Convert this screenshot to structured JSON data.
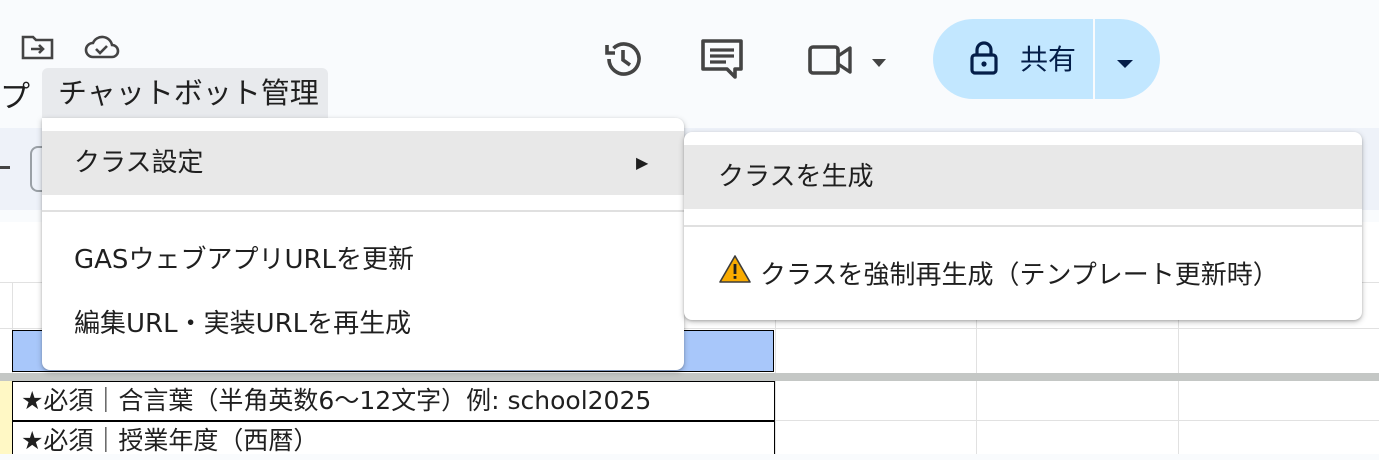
{
  "menubar": {
    "partial_label": "プ",
    "active_menu": "チャットボット管理"
  },
  "header": {
    "share_label": "共有"
  },
  "menu": {
    "items": [
      {
        "label": "クラス設定",
        "submenu_indicator": "▶"
      },
      {
        "label": "GASウェブアプリURLを更新"
      },
      {
        "label": "編集URL・実装URLを再生成"
      }
    ]
  },
  "submenu": {
    "items": [
      {
        "label": "クラスを生成"
      },
      {
        "label": "クラスを強制再生成（テンプレート更新時）",
        "icon": "warning-icon"
      }
    ]
  },
  "sheet": {
    "rows": [
      {
        "text": "★必須｜合言葉（半角英数6～12文字）例: school2025"
      },
      {
        "text": "★必須｜授業年度（西暦）"
      }
    ]
  },
  "colors": {
    "share_bg": "#c2e7ff",
    "highlight": "#e8e8e8",
    "selected_row": "#a8c7fa",
    "warning": "#f9ab00"
  }
}
